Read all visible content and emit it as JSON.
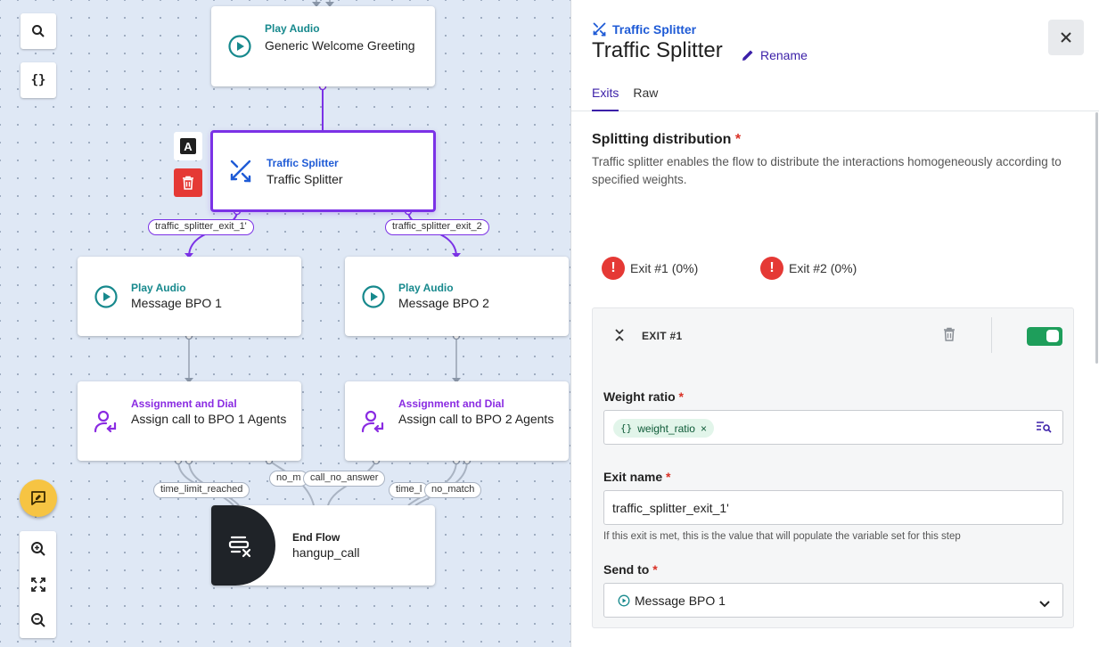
{
  "canvas": {
    "tools": {
      "search_icon": "search-icon",
      "variables_glyph": "{}"
    },
    "nodes": {
      "welcome": {
        "category": "Play Audio",
        "title": "Generic Welcome Greeting"
      },
      "splitter": {
        "category": "Traffic Splitter",
        "title": "Traffic Splitter"
      },
      "bpo1_audio": {
        "category": "Play Audio",
        "title": "Message BPO 1"
      },
      "bpo2_audio": {
        "category": "Play Audio",
        "title": "Message BPO 2"
      },
      "bpo1_dial": {
        "category": "Assignment and Dial",
        "title": "Assign call to BPO 1 Agents"
      },
      "bpo2_dial": {
        "category": "Assignment and Dial",
        "title": "Assign call to BPO 2 Agents"
      },
      "end": {
        "category": "End Flow",
        "title": "hangup_call"
      }
    },
    "edge_labels": {
      "exit1": "traffic_splitter_exit_1'",
      "exit2": "traffic_splitter_exit_2",
      "time_limit_1": "time_limit_reached",
      "no_match_short": "no_m",
      "call_no_answer": "call_no_answer",
      "time_limit_2": "time_l",
      "no_match": "no_match"
    },
    "side_tools": {
      "rename_glyph": "A"
    }
  },
  "panel": {
    "breadcrumb": "Traffic Splitter",
    "title": "Traffic Splitter",
    "rename_label": "Rename",
    "tabs": [
      {
        "label": "Exits",
        "active": true
      },
      {
        "label": "Raw",
        "active": false
      }
    ],
    "section": {
      "title": "Splitting distribution",
      "required_mark": "*",
      "description": "Traffic splitter enables the flow to distribute the interactions homogeneously according to specified weights."
    },
    "exit_summary": [
      {
        "warn": "!",
        "label": "Exit #1 (0%)"
      },
      {
        "warn": "!",
        "label": "Exit #2 (0%)"
      }
    ],
    "exit_card": {
      "label": "EXIT #1",
      "enabled": true,
      "weight_ratio": {
        "label": "Weight ratio",
        "required_mark": "*",
        "chip_glyph": "{}",
        "chip_text": "weight_ratio",
        "chip_remove": "×"
      },
      "exit_name": {
        "label": "Exit name",
        "required_mark": "*",
        "value": "traffic_splitter_exit_1'",
        "helper": "If this exit is met, this is the value that will populate the variable set for this step"
      },
      "send_to": {
        "label": "Send to",
        "required_mark": "*",
        "value": "Message BPO 1"
      }
    }
  },
  "colors": {
    "accent_purple": "#7b32e6",
    "tab_active": "#3b1fa8",
    "teal": "#17898d",
    "toggle_on": "#1e9e5b",
    "warning": "#e53935",
    "delete_red": "#e53935"
  }
}
